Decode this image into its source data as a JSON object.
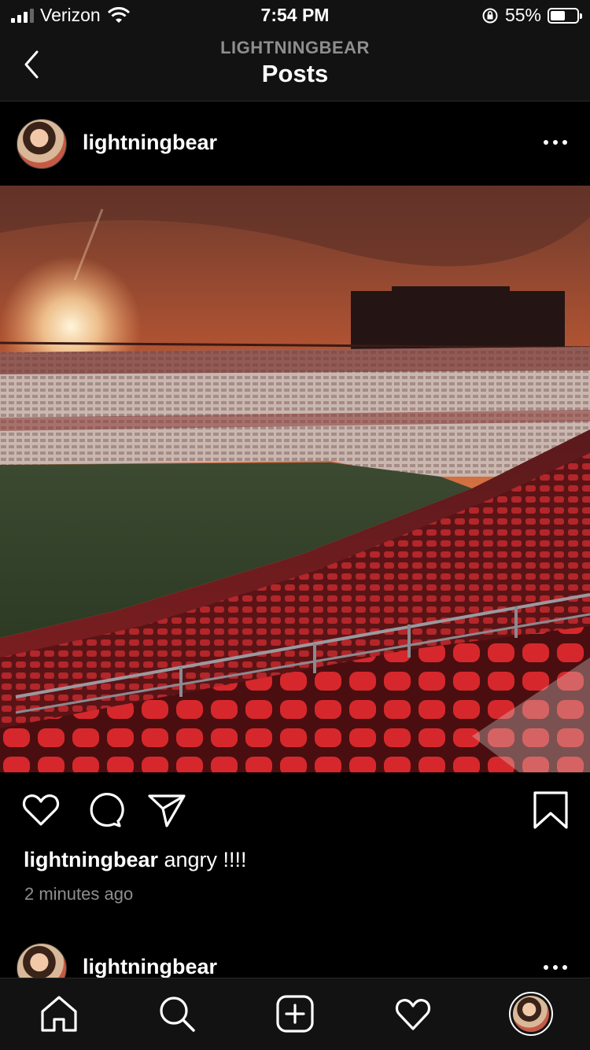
{
  "status_bar": {
    "carrier": "Verizon",
    "time": "7:54 PM",
    "battery": "55%",
    "battery_level": 0.55
  },
  "header": {
    "subtitle": "LIGHTNINGBEAR",
    "title": "Posts"
  },
  "post": {
    "username": "lightningbear",
    "caption_user": "lightningbear",
    "caption_text": " angry !!!!",
    "timestamp": "2 minutes ago"
  },
  "next_post": {
    "username": "lightningbear"
  },
  "icons": {
    "back": "chevron-left-icon",
    "more": "more-horizontal-icon",
    "like": "heart-icon",
    "comment": "comment-icon",
    "share": "paper-plane-icon",
    "save": "bookmark-icon",
    "home": "home-icon",
    "search": "search-icon",
    "new_post": "plus-square-icon",
    "activity": "heart-icon",
    "profile": "avatar"
  },
  "colors": {
    "background": "#000000",
    "bar": "#121212",
    "secondary_text": "#8e8e8e"
  }
}
